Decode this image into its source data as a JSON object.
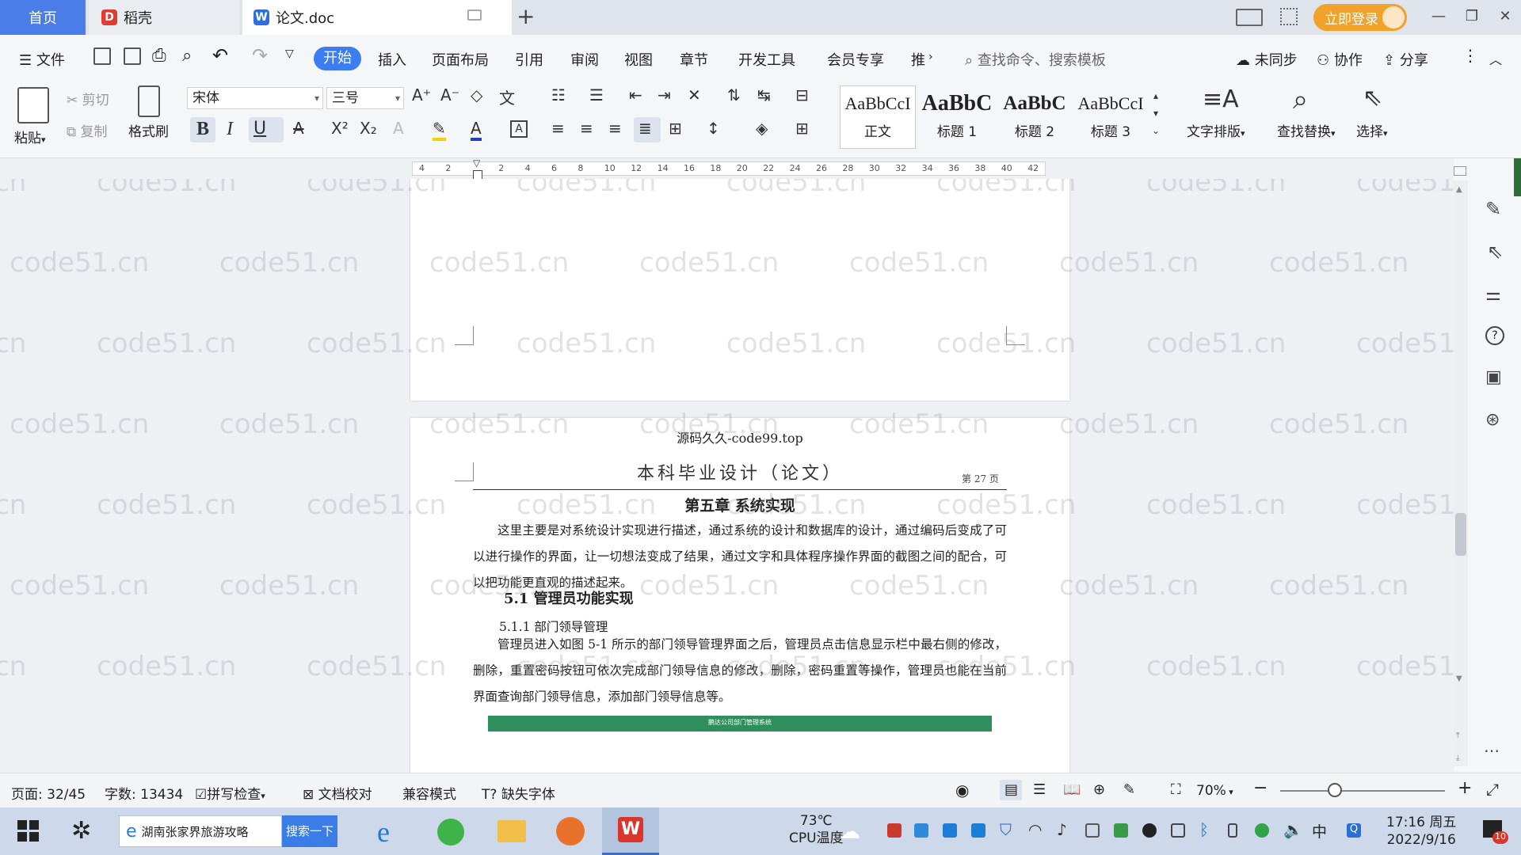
{
  "titlebar": {
    "tab_home": "首页",
    "tab_daoke": "稻壳",
    "tab_doc": "论文.doc",
    "login": "立即登录"
  },
  "menu": {
    "file": "文件",
    "items": [
      "开始",
      "插入",
      "页面布局",
      "引用",
      "审阅",
      "视图",
      "章节",
      "开发工具",
      "会员专享",
      "推"
    ],
    "search_cmd": "查找命令、搜索模板",
    "sync": "未同步",
    "collab": "协作",
    "share": "分享"
  },
  "ribbon": {
    "paste": "粘贴",
    "cut": "剪切",
    "copy": "复制",
    "format_painter": "格式刷",
    "font_name": "宋体",
    "font_size": "三号",
    "styles": [
      {
        "sample": "AaBbCcI",
        "name": "正文"
      },
      {
        "sample": "AaBbC",
        "name": "标题 1"
      },
      {
        "sample": "AaBbC",
        "name": "标题 2"
      },
      {
        "sample": "AaBbCcI",
        "name": "标题 3"
      }
    ],
    "text_layout": "文字排版",
    "find_replace": "查找替换",
    "select": "选择"
  },
  "ruler": {
    "ticks": [
      "4",
      "2",
      "",
      "2",
      "4",
      "6",
      "8",
      "10",
      "12",
      "14",
      "16",
      "18",
      "20",
      "22",
      "24",
      "26",
      "28",
      "30",
      "32",
      "34",
      "36",
      "38",
      "40",
      "42"
    ]
  },
  "document": {
    "source_line": "源码久久-code99.top",
    "header_title": "本科毕业设计（论文）",
    "page_label": "第 27 页",
    "chapter_title": "第五章  系统实现",
    "intro": "这里主要是对系统设计实现进行描述，通过系统的设计和数据库的设计，通过编码后变成了可以进行操作的界面，让一切想法变成了结果，通过文字和具体程序操作界面的截图之间的配合，可以把功能更直观的描述起来。",
    "section_title": "5.1 管理员功能实现",
    "subsection_title": "5.1.1  部门领导管理",
    "body": "管理员进入如图 5-1 所示的部门领导管理界面之后，管理员点击信息显示栏中最右侧的修改，删除，重置密码按钮可依次完成部门领导信息的修改，删除，密码重置等操作，管理员也能在当前界面查询部门领导信息，添加部门领导信息等。",
    "figure_caption": "鹏达公司部门管理系统"
  },
  "watermark": "code51.cn",
  "status": {
    "page": "页面: 32/45",
    "words": "字数: 13434",
    "spellcheck": "拼写检查",
    "proofread": "文档校对",
    "compat": "兼容模式",
    "missing_font": "缺失字体",
    "zoom": "70%"
  },
  "taskbar": {
    "search_text": "湖南张家界旅游攻略",
    "search_btn": "搜索一下",
    "temp": "73℃",
    "temp_label": "CPU温度",
    "ime": "中",
    "time": "17:16 周五",
    "date": "2022/9/16",
    "notif_count": "10"
  },
  "colors": {
    "accent": "#3d7df2",
    "login": "#f0a22a",
    "wps_red": "#d9372b"
  }
}
